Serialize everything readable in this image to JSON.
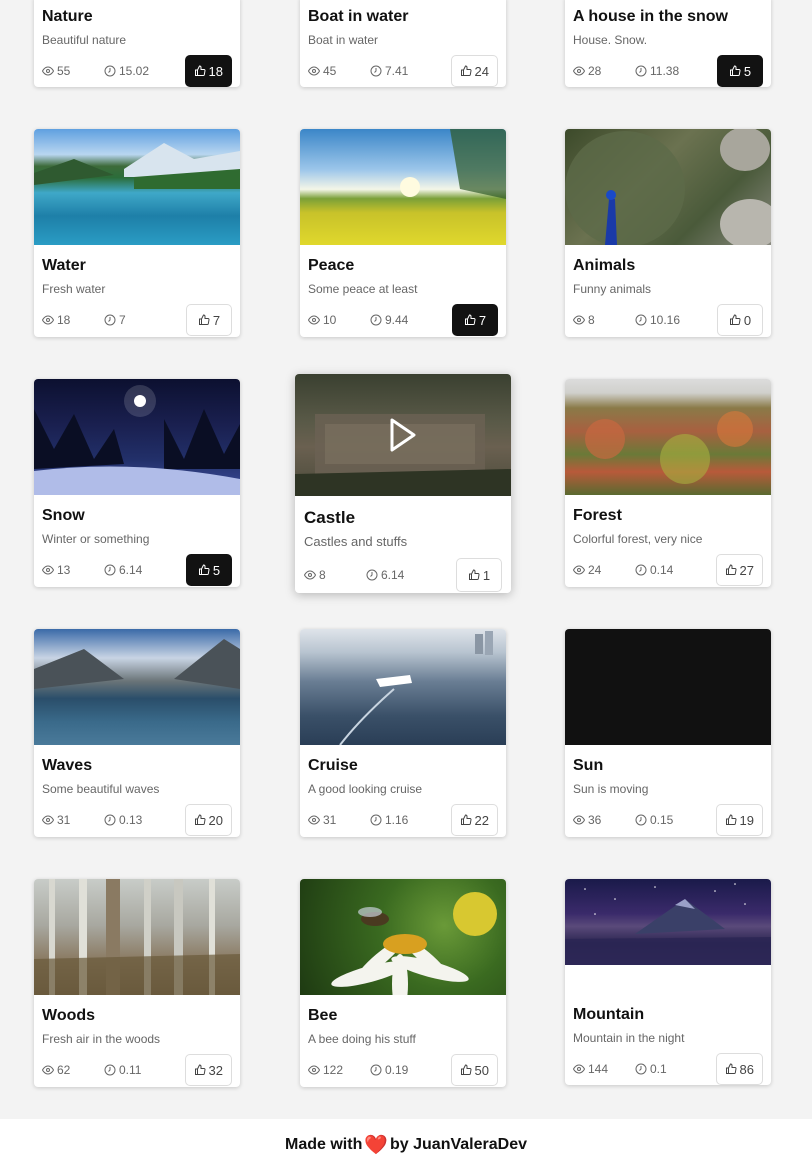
{
  "cards": [
    {
      "title": "Nature",
      "desc": "Beautiful nature",
      "views": "55",
      "time": "15.02",
      "likes": "18",
      "liked": true,
      "image": "none"
    },
    {
      "title": "Boat in water",
      "desc": "Boat in water",
      "views": "45",
      "time": "7.41",
      "likes": "24",
      "liked": false,
      "image": "none"
    },
    {
      "title": "A house in the snow",
      "desc": "House. Snow.",
      "views": "28",
      "time": "11.38",
      "likes": "5",
      "liked": true,
      "image": "none"
    },
    {
      "title": "Water",
      "desc": "Fresh water",
      "views": "18",
      "time": "7",
      "likes": "7",
      "liked": false,
      "image": "river-valley"
    },
    {
      "title": "Peace",
      "desc": "Some peace at least",
      "views": "10",
      "time": "9.44",
      "likes": "7",
      "liked": true,
      "image": "flower-field"
    },
    {
      "title": "Animals",
      "desc": "Funny animals",
      "views": "8",
      "time": "10.16",
      "likes": "0",
      "liked": false,
      "image": "peacock"
    },
    {
      "title": "Snow",
      "desc": "Winter or something",
      "views": "13",
      "time": "6.14",
      "likes": "5",
      "liked": true,
      "image": "snowy-night"
    },
    {
      "title": "Castle",
      "desc": "Castles and stuffs",
      "views": "8",
      "time": "6.14",
      "likes": "1",
      "liked": false,
      "image": "castle-aerial",
      "playing": true
    },
    {
      "title": "Forest",
      "desc": "Colorful forest, very nice",
      "views": "24",
      "time": "0.14",
      "likes": "27",
      "liked": false,
      "image": "autumn-forest"
    },
    {
      "title": "Waves",
      "desc": "Some beautiful waves",
      "views": "31",
      "time": "0.13",
      "likes": "20",
      "liked": false,
      "image": "lake-waves"
    },
    {
      "title": "Cruise",
      "desc": "A good looking cruise",
      "views": "31",
      "time": "1.16",
      "likes": "22",
      "liked": false,
      "image": "cruise-ship"
    },
    {
      "title": "Sun",
      "desc": "Sun is moving",
      "views": "36",
      "time": "0.15",
      "likes": "19",
      "liked": false,
      "image": "black-frame"
    },
    {
      "title": "Woods",
      "desc": "Fresh air in the woods",
      "views": "62",
      "time": "0.11",
      "likes": "32",
      "liked": false,
      "image": "birch-woods"
    },
    {
      "title": "Bee",
      "desc": "A bee doing his stuff",
      "views": "122",
      "time": "0.19",
      "likes": "50",
      "liked": false,
      "image": "bee-flower"
    },
    {
      "title": "Mountain",
      "desc": "Mountain in the night",
      "views": "144",
      "time": "0.1",
      "likes": "86",
      "liked": false,
      "image": "night-mountain"
    }
  ],
  "footer": {
    "prefix": "Made with",
    "heart": "❤️",
    "suffix": "by JuanValeraDev"
  },
  "icons": {
    "views": "eye-icon",
    "time": "clock-icon",
    "like": "thumbs-up-icon",
    "play": "play-icon"
  },
  "colors": {
    "liked_bg": "#121212",
    "heart": "#d22"
  }
}
